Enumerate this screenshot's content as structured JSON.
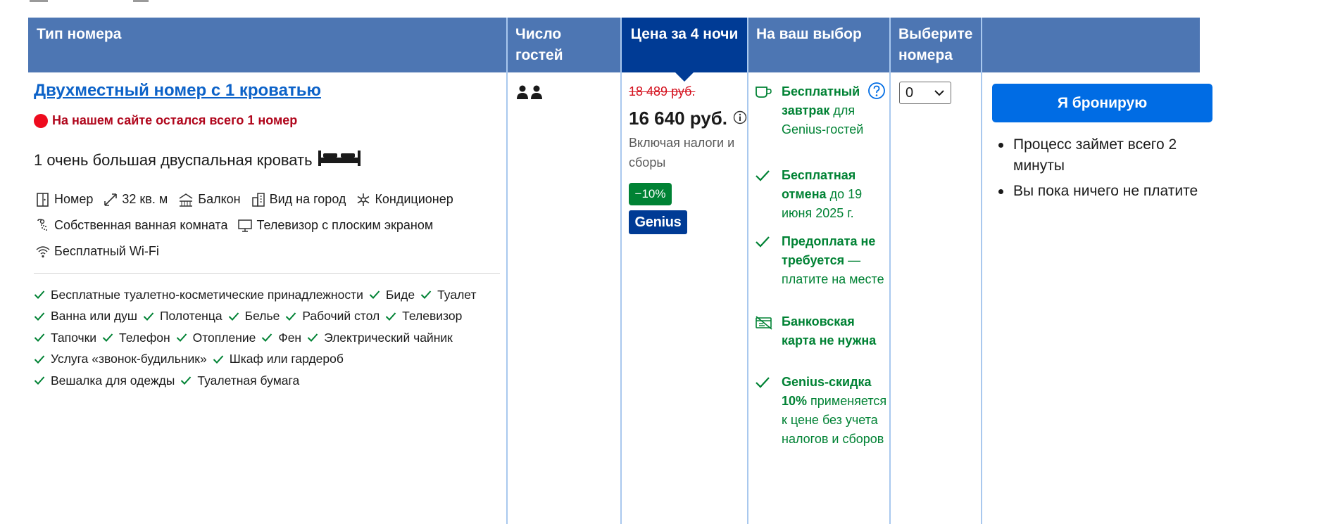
{
  "header": {
    "room_type": "Тип номера",
    "guests": "Число гостей",
    "price": "Цена за 4 ночи",
    "choice": "На ваш выбор",
    "select": "Выберите номера"
  },
  "room": {
    "title": "Двухместный номер с 1 кроватью",
    "scarcity": "На нашем сайте остался всего 1 номер",
    "bed": "1 очень большая двуспальная кровать",
    "facilities": [
      {
        "label": "Номер",
        "icon": "room-icon"
      },
      {
        "label": "32 кв. м",
        "icon": "size-icon"
      },
      {
        "label": "Балкон",
        "icon": "balcony-icon"
      },
      {
        "label": "Вид на город",
        "icon": "city-view-icon"
      },
      {
        "label": "Кондиционер",
        "icon": "snowflake-icon"
      },
      {
        "label": "Собственная ванная комната",
        "icon": "bath-icon"
      },
      {
        "label": "Телевизор с плоским экраном",
        "icon": "tv-icon"
      },
      {
        "label": "Бесплатный Wi-Fi",
        "icon": "wifi-icon"
      }
    ],
    "amenities": [
      [
        "Бесплатные туалетно-косметические принадлежности",
        "Биде",
        "Туалет"
      ],
      [
        "Ванна или душ",
        "Полотенца",
        "Белье",
        "Рабочий стол",
        "Телевизор"
      ],
      [
        "Тапочки",
        "Телефон",
        "Отопление",
        "Фен",
        "Электрический чайник"
      ],
      [
        "Услуга «звонок-будильник»",
        "Шкаф или гардероб"
      ],
      [
        "Вешалка для одежды",
        "Туалетная бумага"
      ]
    ]
  },
  "price": {
    "old": "18 489 руб.",
    "current": "16 640 руб.",
    "taxes": "Включая налоги и сборы",
    "discount": "−10%",
    "genius": "Genius"
  },
  "conditions": [
    {
      "icon": "cup-icon",
      "bold": "Бесплатный завтрак",
      "rest": " для Genius-гостей"
    },
    {
      "icon": "check-icon",
      "bold": "Бесплатная отмена",
      "rest": " до 19 июня 2025 г."
    },
    {
      "icon": "check-icon",
      "bold": "Предоплата не требуется",
      "rest": " — платите на месте"
    },
    {
      "icon": "no-card-icon",
      "bold": "Банковская карта не нужна",
      "rest": ""
    },
    {
      "icon": "check-icon",
      "bold": "Genius-скидка 10%",
      "rest": " применяется к цене без учета налогов и сборов"
    }
  ],
  "select": {
    "value": "0"
  },
  "booking": {
    "button": "Я бронирую",
    "bullets": [
      "Процесс займет всего 2 минуты",
      "Вы пока ничего не платите"
    ]
  },
  "colors": {
    "header_bg": "#4d76b3",
    "active_header_bg": "#003b95",
    "link": "#0c62c8",
    "green": "#008234",
    "red": "#d4111e",
    "button": "#006ce4"
  }
}
